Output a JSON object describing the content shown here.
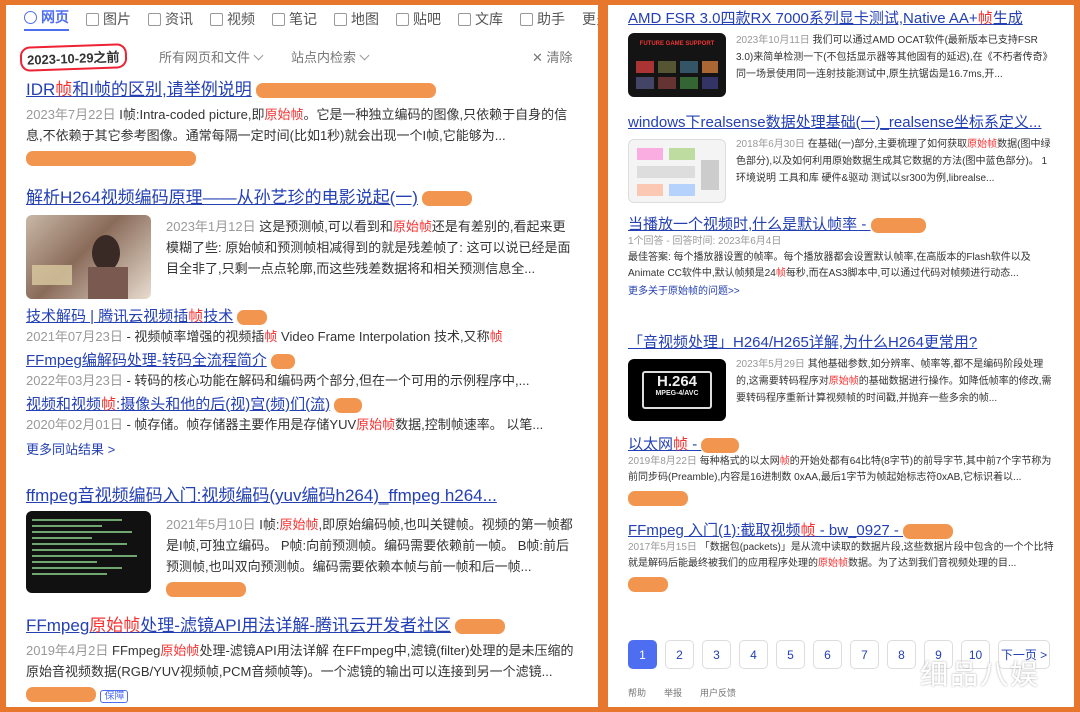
{
  "tabs": [
    {
      "icon": "search-icon",
      "label": "网页",
      "active": true
    },
    {
      "icon": "image-icon",
      "label": "图片"
    },
    {
      "icon": "news-icon",
      "label": "资讯"
    },
    {
      "icon": "video-icon",
      "label": "视频"
    },
    {
      "icon": "note-icon",
      "label": "笔记"
    },
    {
      "icon": "map-icon",
      "label": "地图"
    },
    {
      "icon": "tieba-icon",
      "label": "贴吧"
    },
    {
      "icon": "doc-icon",
      "label": "文库"
    },
    {
      "icon": "ai-icon",
      "label": "助手"
    },
    {
      "label": "更多"
    }
  ],
  "filters": {
    "date": "2023-10-29之前",
    "scope": "所有网页和文件",
    "site": "站点内检索",
    "clear": "清除"
  },
  "left": [
    {
      "title_a": "IDR",
      "title_hl": "帧",
      "title_b": "和I帧的区别,请举例说明",
      "date": "2023年7月22日",
      "text_a": "I帧:Intra-coded picture,即",
      "text_hl": "原始帧",
      "text_b": "。它是一种独立编码的图像,只依赖于自身的信息,不依赖于其它参考图像。通常每隔一定时间(比如1秒)就会出现一个I帧,它能够为..."
    },
    {
      "title": "解析H264视频编码原理——从孙艺珍的电影说起(一)",
      "date": "2023年1月12日",
      "text_a": "这是预测帧,可以看到和",
      "text_hl": "原始帧",
      "text_b": "还是有差别的,看起来更模糊了些: 原始帧和预测帧相减得到的就是残差帧了: 这可以说已经是面目全非了,只剩一点点轮廓,而这些残差数据将和相关预测信息全..."
    },
    {
      "title_a": "技术解码 | 腾讯云视频插",
      "title_hl": "帧",
      "title_b": "技术",
      "date": "2021年07月23日",
      "text_a": "视频帧率增强的视频插",
      "text_hl": "帧",
      "text_b": " Video Frame Interpolation 技术,又称",
      "text_hl2": "帧"
    },
    {
      "title": "FFmpeg编解码处理-转码全流程简介",
      "date": "2022年03月23日",
      "text": "转码的核心功能在解码和编码两个部分,但在一个可用的示例程序中,..."
    },
    {
      "title_a": "视频和视频",
      "title_hl": "帧",
      "title_b": ":摄像头和他的后(视)宫(频)们(流)",
      "date": "2020年02月01日",
      "text_a": "帧存储。帧存储器主要作用是存储YUV",
      "text_hl": "原始帧",
      "text_b": "数据,控制帧速率。 以笔..."
    },
    {
      "more": "更多同站结果 >"
    },
    {
      "title": "ffmpeg音视频编码入门:视频编码(yuv编码h264)_ffmpeg h264...",
      "date": "2021年5月10日",
      "text_a": "I帧:",
      "text_hl": "原始帧",
      "text_b": ",即原始编码帧,也叫关键帧。视频的第一帧都是I帧,可独立编码。 P帧:向前预测帧。编码需要依赖前一帧。 B帧:前后预测帧,也叫双向预测帧。编码需要依赖本帧与前一帧和后一帧..."
    },
    {
      "title_a": "FFmpeg",
      "title_hl": "原始帧",
      "title_b": "处理-滤镜API用法详解-腾讯云开发者社区",
      "date": "2019年4月2日",
      "text_a": "FFmpeg",
      "text_hl": "原始帧",
      "text_b": "处理-滤镜API用法详解 在FFmpeg中,滤镜(filter)处理的是未压缩的原始音视频数据(RGB/YUV视频帧,PCM音频帧等)。一个滤镜的输出可以连接到另一个滤镜...",
      "badge": "保障"
    }
  ],
  "right": [
    {
      "title_a": "AMD FSR 3.0四款RX 7000系列显卡测试,Native AA+",
      "title_hl": "帧",
      "title_b": "生成",
      "date": "2023年10月11日",
      "text": "我们可以通过AMD OCAT软件(最新版本已支持FSR 3.0)来简单检测一下(不包括显示器等其他固有的延迟),在《不朽者传奇》同一场景使用同一连射技能测试中,原生抗锯齿是16.7ms,开..."
    },
    {
      "title": "windows下realsense数据处理基础(一)_realsense坐标系定义...",
      "date": "2018年6月30日",
      "text_a": "在基础(一)部分,主要梳理了如何获取",
      "text_hl": "原始帧",
      "text_b": "数据(图中绿色部分),以及如何利用原始数据生成其它数据的方法(图中蓝色部分)。 1 环境说明 工具和库 硬件&驱动 测试以sr300为例,librealse..."
    },
    {
      "title": "当播放一个视频时,什么是默认帧率",
      "sub": "1个回答 - 回答时间: 2023年6月4日",
      "text_a": "最佳答案: 每个播放器设置的帧率。每个播放器都会设置默认帧率,在高版本的Flash软件以及Animate CC软件中,默认帧频是24",
      "text_hl": "帧",
      "text_b": "每秒,而在AS3脚本中,可以通过代码对帧频进行动态...",
      "more": "更多关于原始帧的问题>>"
    },
    {
      "title": "「音视频处理」H264/H265详解,为什么H264更常用?",
      "date": "2023年5月29日",
      "text_a": "其他基础参数,如分辨率、帧率等,都不是编码阶段处理的,这需要转码程序对",
      "text_hl": "原始帧",
      "text_b": "的基础数据进行操作。如降低帧率的修改,需要转码程序重新计算视频帧的时间戳,并抛弃一些多余的帧..."
    },
    {
      "title_a": "以太网",
      "title_hl": "帧",
      "title_b": "",
      "date": "2019年8月22日",
      "text_a": "每种格式的以太网",
      "text_hl": "帧",
      "text_b": "的开始处都有64比特(8字节)的前导字节,其中前7个字节称为前同步码(Preamble),内容是16进制数 0xAA,最后1字节为帧起始标志符0xAB,它标识着以..."
    },
    {
      "title_a": "FFmpeg 入门(1):截取视频",
      "title_hl": "帧",
      "title_b": " - bw_0927",
      "date": "2017年5月15日",
      "text_a": "「数据包(packets)」是从流中读取的数据片段,这些数据片段中包含的一个个比特就是解码后能最终被我们的应用程序处理的",
      "text_hl": "原始帧",
      "text_b": "数据。为了达到我们音视频处理的目..."
    }
  ],
  "thumbs": {
    "amd": "FUTURE GAME SUPPORT",
    "h264": "H.264",
    "h264b": "MPEG-4/AVC"
  },
  "pager": [
    "1",
    "2",
    "3",
    "4",
    "5",
    "6",
    "7",
    "8",
    "9",
    "10",
    "下一页 >"
  ],
  "footer": [
    "帮助",
    "举报",
    "用户反馈"
  ],
  "watermark": "细品八娱"
}
